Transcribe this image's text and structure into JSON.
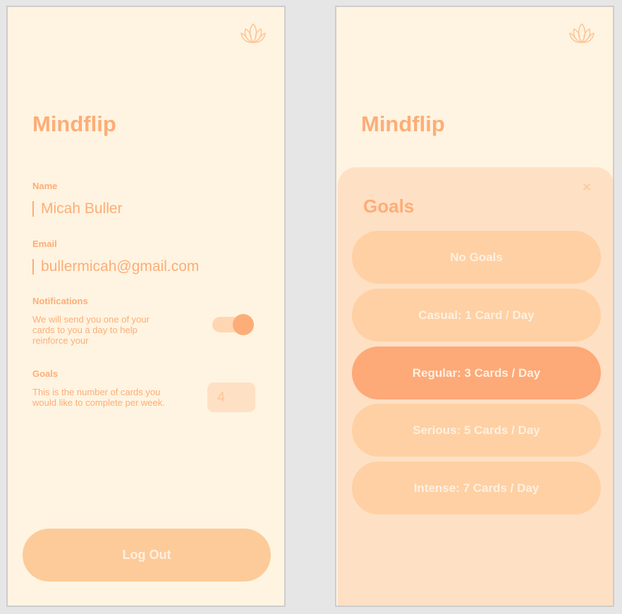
{
  "colors": {
    "background": "#fff4e1",
    "accent": "#fdad78",
    "sheet": "#fee0c4",
    "option": "#fed0a3",
    "option_selected": "#fda978",
    "button_text": "#fff0e0"
  },
  "icons": {
    "logo": "lotus-icon",
    "close": "close-icon"
  },
  "settings_screen": {
    "app_title": "Mindflip",
    "name_label": "Name",
    "name_value": "Micah Buller",
    "email_label": "Email",
    "email_value": "bullermicah@gmail.com",
    "notifications_label": "Notifications",
    "notifications_desc": "We will send you one of your cards to you a day to help reinforce your",
    "notifications_on": true,
    "goals_label": "Goals",
    "goals_desc": "This is the number of cards you would like to complete per week.",
    "goals_value": "4",
    "logout_label": "Log Out"
  },
  "goals_screen": {
    "app_title": "Mindflip",
    "sheet_title": "Goals",
    "close_glyph": "✕",
    "options": [
      {
        "label": "No Goals",
        "selected": false
      },
      {
        "label": "Casual: 1 Card / Day",
        "selected": false
      },
      {
        "label": "Regular: 3 Cards / Day",
        "selected": true
      },
      {
        "label": "Serious: 5 Cards / Day",
        "selected": false
      },
      {
        "label": "Intense: 7 Cards / Day",
        "selected": false
      }
    ]
  }
}
